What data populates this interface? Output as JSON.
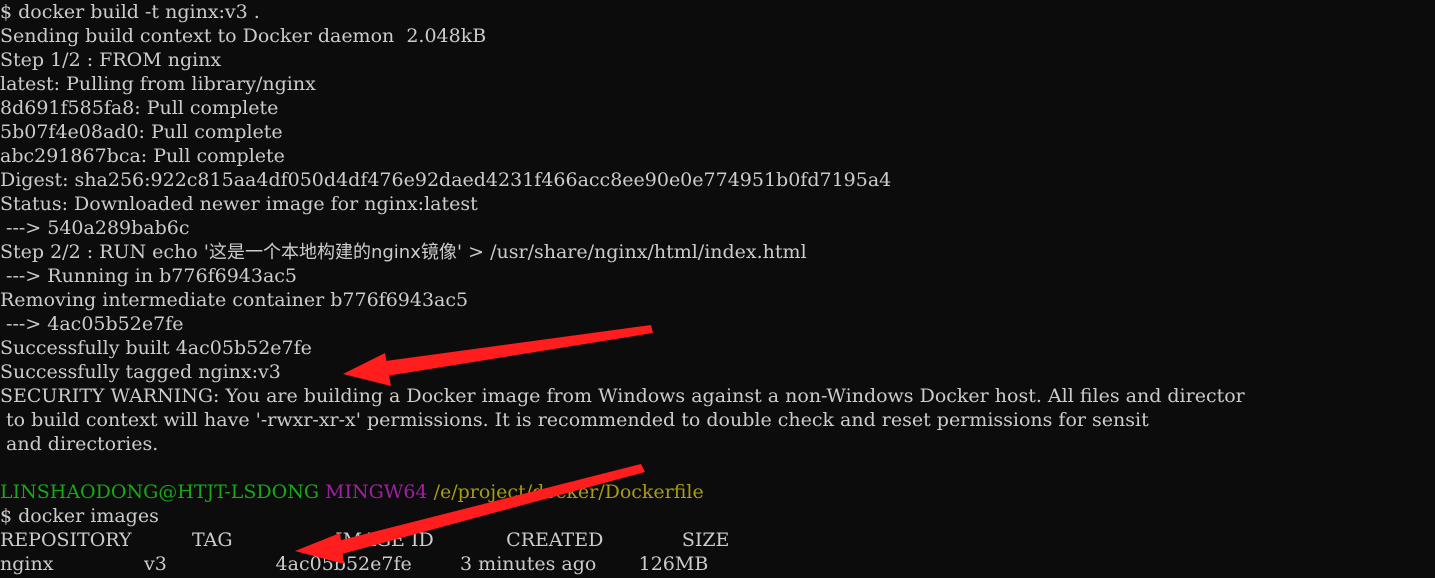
{
  "terminal": {
    "background_color": "#0c0c0c",
    "foreground_color": "#cccccc",
    "prompt_user_color": "#16a816",
    "prompt_shell_color": "#a021a0",
    "prompt_path_color": "#a89b17",
    "annotation_color": "#ff1d1d",
    "lines": {
      "l01": "$ docker build -t nginx:v3 .",
      "l02": "Sending build context to Docker daemon  2.048kB",
      "l03": "Step 1/2 : FROM nginx",
      "l04": "latest: Pulling from library/nginx",
      "l05": "8d691f585fa8: Pull complete",
      "l06": "5b07f4e08ad0: Pull complete",
      "l07": "abc291867bca: Pull complete",
      "l08": "Digest: sha256:922c815aa4df050d4df476e92daed4231f466acc8ee90e0e774951b0fd7195a4",
      "l09": "Status: Downloaded newer image for nginx:latest",
      "l10": " ---> 540a289bab6c",
      "l11_pre": "Step 2/2 : RUN echo '",
      "l11_cjk": "这是一个本地构建的nginx镜像",
      "l11_post": "' > /usr/share/nginx/html/index.html",
      "l12": " ---> Running in b776f6943ac5",
      "l13": "Removing intermediate container b776f6943ac5",
      "l14": " ---> 4ac05b52e7fe",
      "l15": "Successfully built 4ac05b52e7fe",
      "l16": "Successfully tagged nginx:v3",
      "l17": "SECURITY WARNING: You are building a Docker image from Windows against a non-Windows Docker host. All files and director",
      "l18": " to build context will have '-rwxr-xr-x' permissions. It is recommended to double check and reset permissions for sensit",
      "l19": " and directories.",
      "l20": "",
      "l21_user": "LINSHAODONG@HTJT-LSDONG",
      "l21_shell": "MINGW64",
      "l21_path": "/e/project/docker/Dockerfile",
      "l22": "$ docker images",
      "l23": "REPOSITORY          TAG                 IMAGE ID            CREATED             SIZE",
      "l24": "nginx               v3                  4ac05b52e7fe        3 minutes ago       126MB"
    },
    "images_table": {
      "headers": [
        "REPOSITORY",
        "TAG",
        "IMAGE ID",
        "CREATED",
        "SIZE"
      ],
      "rows": [
        [
          "nginx",
          "v3",
          "4ac05b52e7fe",
          "3 minutes ago",
          "126MB"
        ]
      ]
    },
    "annotations": [
      {
        "name": "arrow-to-tagged-nginx-v3",
        "target_text": "Successfully tagged nginx:v3"
      },
      {
        "name": "arrow-to-images-tag-v3",
        "target_text": "v3"
      }
    ]
  }
}
